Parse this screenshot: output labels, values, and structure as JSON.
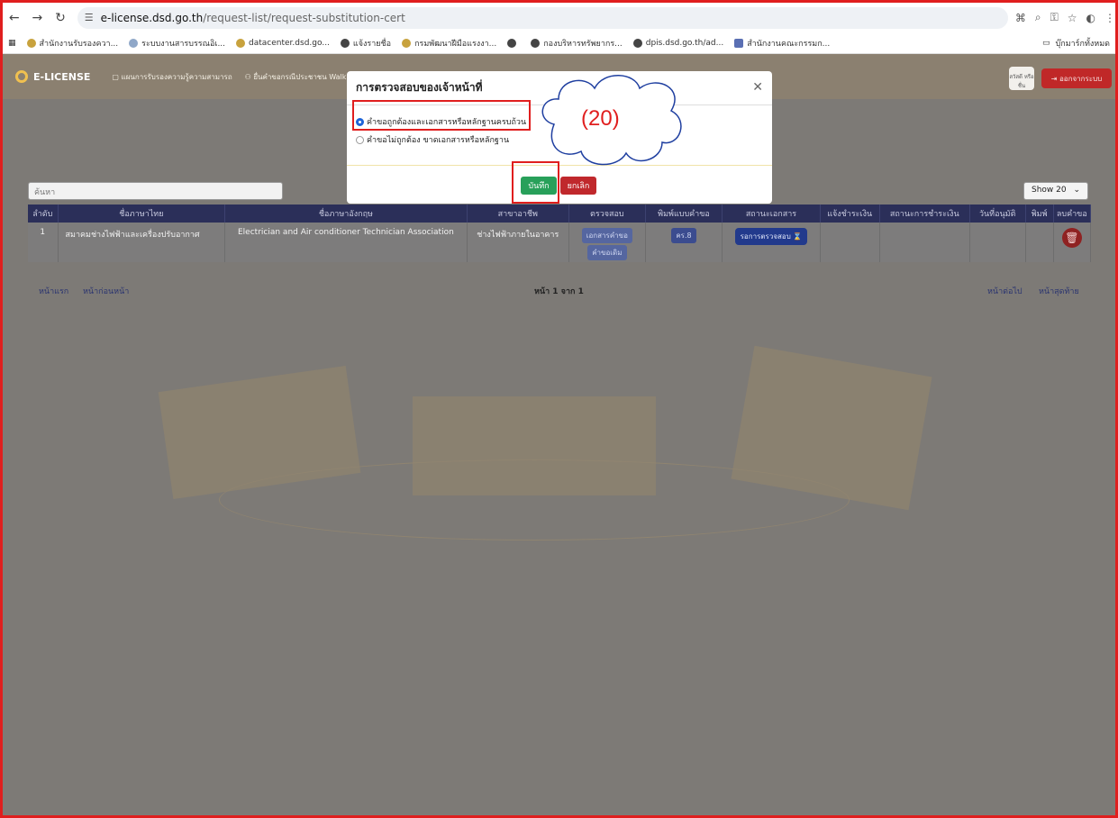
{
  "browser": {
    "url_host": "e-license.dsd.go.th",
    "url_path": "/request-list/request-substitution-cert",
    "bookmarks": [
      {
        "label": "สำนักงานรับรองควา..."
      },
      {
        "label": "ระบบงานสารบรรณอิเ..."
      },
      {
        "label": "datacenter.dsd.go..."
      },
      {
        "label": "แจ้งรายชื่อ"
      },
      {
        "label": "กรมพัฒนาฝีมือแรงงา..."
      },
      {
        "label": "กองบริหารทรัพยากร..."
      },
      {
        "label": "dpis.dsd.go.th/ad..."
      },
      {
        "label": "สำนักงานคณะกรรมก..."
      }
    ],
    "all_bookmarks": "บุ๊กมาร์กทั้งหมด"
  },
  "app": {
    "brand": "E-LICENSE",
    "nav": [
      "แผนการรับรองความรู้ความสามารถ",
      "ยื่นคำขอกรณีประชาชน Walk i"
    ],
    "user_chip": "สวัสดี หรือชื่น",
    "logout": "ออกจากระบบ"
  },
  "list": {
    "search_placeholder": "ค้นหา",
    "show": "Show 20",
    "columns": [
      "ลำดับ",
      "ชื่อภาษาไทย",
      "ชื่อภาษาอังกฤษ",
      "สาขาอาชีพ",
      "ตรวจสอบ",
      "พิมพ์แบบคำขอ",
      "สถานะเอกสาร",
      "แจ้งชำระเงิน",
      "สถานะการชำระเงิน",
      "วันที่อนุมัติ",
      "พิมพ์",
      "ลบคำขอ"
    ],
    "rows": [
      {
        "no": "1",
        "name_th": "สมาคมช่างไฟฟ้าและเครื่องปรับอากาศ",
        "name_en": "Electrician and Air conditioner Technician Association",
        "branch": "ช่างไฟฟ้าภายในอาคาร",
        "check_docs": "เอกสารคำขอ",
        "check_old": "คำขอเดิม",
        "print_form": "คร.8",
        "status": "รอการตรวจสอบ"
      }
    ],
    "pager": {
      "first": "หน้าแรก",
      "prev": "หน้าก่อนหน้า",
      "info": "หน้า 1 จาก 1",
      "next": "หน้าต่อไป",
      "last": "หน้าสุดท้าย"
    }
  },
  "modal": {
    "title": "การตรวจสอบของเจ้าหน้าที่",
    "option_ok": "คำขอถูกต้องและเอกสารหรือหลักฐานครบถ้วน",
    "option_bad": "คำขอไม่ถูกต้อง ขาดเอกสารหรือหลักฐาน",
    "selected": "option_ok",
    "save": "บันทึก",
    "cancel": "ยกเลิก"
  },
  "annotation": {
    "step": "(20)",
    "color": "#e01e1e"
  }
}
